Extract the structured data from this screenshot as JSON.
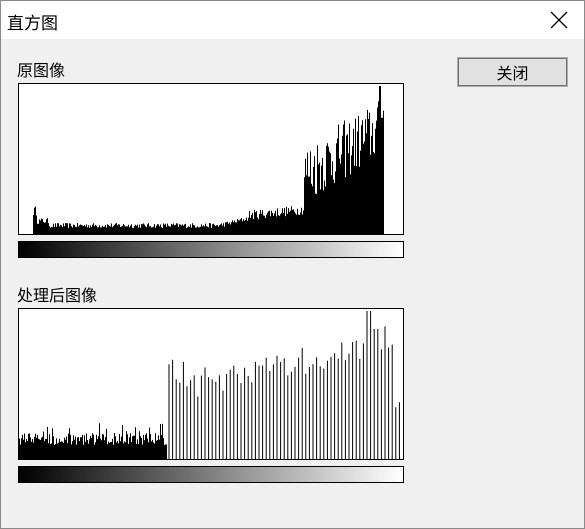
{
  "window": {
    "title": "直方图",
    "close_icon": "close-icon"
  },
  "original": {
    "label": "原图像"
  },
  "processed": {
    "label": "处理后图像"
  },
  "buttons": {
    "close_label": "关闭"
  },
  "colors": {
    "background": "#f0f0f0",
    "histogram_fill": "#000000",
    "histogram_bg": "#ffffff"
  }
}
